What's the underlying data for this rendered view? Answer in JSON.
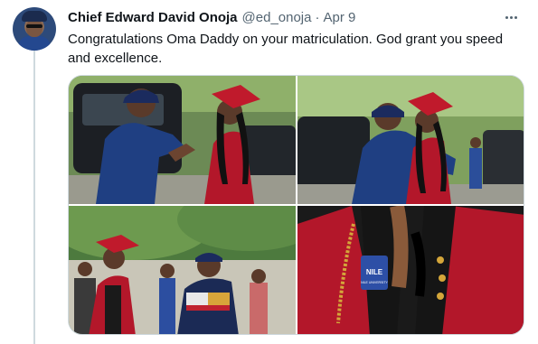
{
  "tweet": {
    "author_name": "Chief Edward David Onoja",
    "handle": "@ed_onoja",
    "separator": "·",
    "date": "Apr 9",
    "text": "Congratulations Oma Daddy on your matriculation. God grant you speed and excellence."
  },
  "media": {
    "photos": [
      {
        "subject": "man in blue cap embracing student in red gown beside black SUV"
      },
      {
        "subject": "man in blue uniform hugging student in red gown and mortarboard"
      },
      {
        "subject": "student in red gown walking with man in patterned shirt under trees"
      },
      {
        "subject": "close-up of red academic gown with gold chain and NILE university badge"
      }
    ],
    "badge_text": "NILE",
    "badge_subtext": "NILE UNIVERSITY"
  },
  "icons": {
    "more": "more-options-icon"
  },
  "colors": {
    "text_primary": "#0f1419",
    "text_secondary": "#536471",
    "border": "#cfd9de",
    "gown_red": "#b3172a",
    "uniform_blue": "#1f3f82"
  }
}
